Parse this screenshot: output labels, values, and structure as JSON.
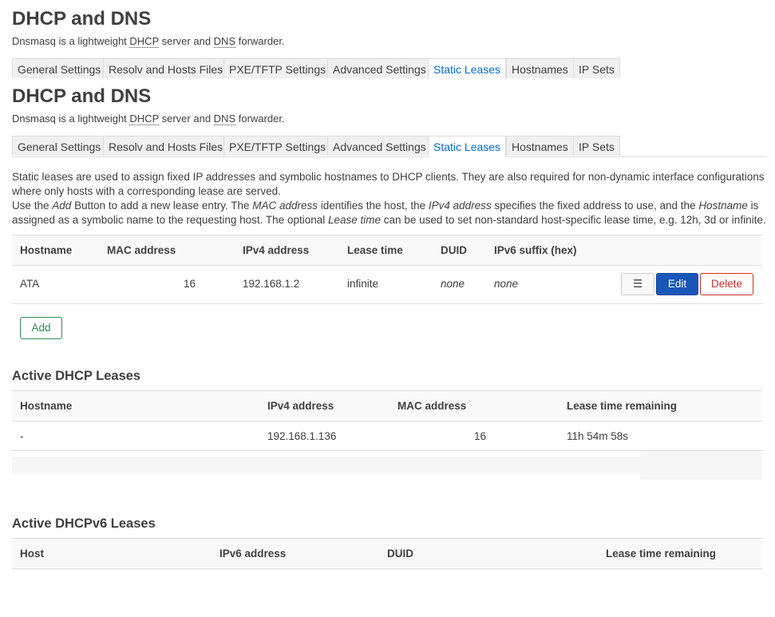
{
  "page": {
    "title": "DHCP and DNS",
    "description_prefix": "Dnsmasq is a lightweight ",
    "abbr_dhcp": "DHCP",
    "description_mid": " server and ",
    "abbr_dns": "DNS",
    "description_suffix": " forwarder."
  },
  "tabs": [
    {
      "label": "General Settings"
    },
    {
      "label": "Resolv and Hosts Files"
    },
    {
      "label": "PXE/TFTP Settings"
    },
    {
      "label": "Advanced Settings"
    },
    {
      "label": "Static Leases"
    },
    {
      "label": "Hostnames"
    },
    {
      "label": "IP Sets"
    }
  ],
  "active_tab": "Static Leases",
  "static_leases": {
    "intro": {
      "line1": "Static leases are used to assign fixed IP addresses and symbolic hostnames to DHCP clients. They are also required for non-dynamic interface configurations",
      "line2": "where only hosts with a corresponding lease are served.",
      "l3_a": "Use the ",
      "l3_add": "Add",
      "l3_b": " Button to add a new lease entry. The ",
      "l3_mac": "MAC address",
      "l3_c": " identifies the host, the ",
      "l3_ipv4": "IPv4 address",
      "l3_d": " specifies the fixed address to use, and the ",
      "l3_host": "Hostname",
      "l3_e": " is",
      "l4_a": "assigned as a symbolic name to the requesting host. The optional ",
      "l4_lt": "Lease time",
      "l4_b": " can be used to set non-standard host-specific lease time, e.g. 12h, 3d or infinite."
    },
    "columns": [
      "Hostname",
      "MAC address",
      "IPv4 address",
      "Lease time",
      "DUID",
      "IPv6 suffix (hex)"
    ],
    "rows": [
      {
        "hostname": "ATA",
        "mac": "16",
        "ipv4": "192.168.1.2",
        "lease_time": "infinite",
        "duid": "none",
        "ipv6_suffix": "none"
      }
    ],
    "menu_button": "☰",
    "edit_button": "Edit",
    "delete_button": "Delete",
    "add_button": "Add"
  },
  "active_dhcp": {
    "heading": "Active DHCP Leases",
    "columns": [
      "Hostname",
      "IPv4 address",
      "MAC address",
      "Lease time remaining"
    ],
    "rows": [
      {
        "hostname": "-",
        "ipv4": "192.168.1.136",
        "mac": "16",
        "remaining": "11h 54m 58s"
      }
    ]
  },
  "active_dhcpv6": {
    "heading": "Active DHCPv6 Leases",
    "columns": [
      "Host",
      "IPv6 address",
      "DUID",
      "Lease time remaining"
    ]
  },
  "colors": {
    "accent": "#0069d6",
    "edit": "#1a56b8",
    "delete": "#c9302c",
    "add": "#2e8b57"
  }
}
